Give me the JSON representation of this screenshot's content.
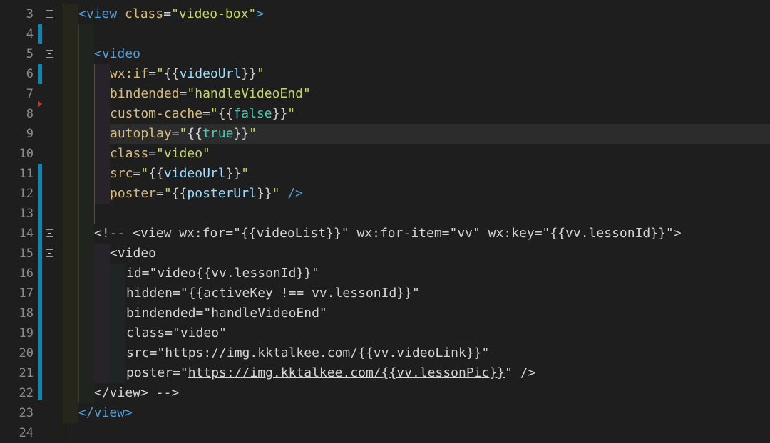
{
  "editor": {
    "line_numbers": [
      "3",
      "4",
      "5",
      "6",
      "7",
      "8",
      "9",
      "10",
      "11",
      "12",
      "13",
      "14",
      "15",
      "16",
      "17",
      "18",
      "19",
      "20",
      "21",
      "22",
      "23",
      "24"
    ],
    "lines": [
      {
        "t": "<view class=\"video-box\">"
      },
      {
        "t": ""
      },
      {
        "t": "<video"
      },
      {
        "t": "wx:if=\"{{videoUrl}}\""
      },
      {
        "t": "bindended=\"handleVideoEnd\""
      },
      {
        "t": "custom-cache=\"{{false}}\""
      },
      {
        "t": "autoplay=\"{{true}}\""
      },
      {
        "t": "class=\"video\""
      },
      {
        "t": "src=\"{{videoUrl}}\""
      },
      {
        "t": "poster=\"{{posterUrl}}\" />"
      },
      {
        "t": ""
      },
      {
        "t": "<!-- <view wx:for=\"{{videoList}}\" wx:for-item=\"vv\" wx:key=\"{{vv.lessonId}}\">"
      },
      {
        "t": "<video"
      },
      {
        "t": "id=\"video{{vv.lessonId}}\""
      },
      {
        "t": "hidden=\"{{activeKey !== vv.lessonId}}\""
      },
      {
        "t": "bindended=\"handleVideoEnd\""
      },
      {
        "t": "class=\"video\""
      },
      {
        "t": "src=\"https://img.kktalkee.com/{{vv.videoLink}}\""
      },
      {
        "t": "poster=\"https://img.kktalkee.com/{{vv.lessonPic}}\" />"
      },
      {
        "t": "</view> -->"
      },
      {
        "t": "</view>"
      },
      {
        "t": ""
      }
    ],
    "tokens": {
      "l3_tag": "<view",
      "l3_attr": " class",
      "l3_eq": "=",
      "l3_str": "\"video-box\"",
      "l3_close": ">",
      "l5_tag": "<video",
      "l6_attr": "wx:if",
      "l6_eq": "=",
      "l6_q1": "\"",
      "l6_m1": "{{",
      "l6_var": "videoUrl",
      "l6_m2": "}}",
      "l6_q2": "\"",
      "l7_attr": "bindended",
      "l7_eq": "=",
      "l7_str": "\"handleVideoEnd\"",
      "l8_attr": "custom-cache",
      "l8_eq": "=",
      "l8_q1": "\"",
      "l8_m1": "{{",
      "l8_bool": "false",
      "l8_m2": "}}",
      "l8_q2": "\"",
      "l9_attr": "autoplay",
      "l9_eq": "=",
      "l9_q1": "\"",
      "l9_m1": "{{",
      "l9_bool": "true",
      "l9_m2": "}}",
      "l9_q2": "\"",
      "l10_attr": "class",
      "l10_eq": "=",
      "l10_str": "\"video\"",
      "l11_attr": "src",
      "l11_eq": "=",
      "l11_q1": "\"",
      "l11_m1": "{{",
      "l11_var": "videoUrl",
      "l11_m2": "}}",
      "l11_q2": "\"",
      "l12_attr": "poster",
      "l12_eq": "=",
      "l12_q1": "\"",
      "l12_m1": "{{",
      "l12_var": "posterUrl",
      "l12_m2": "}}",
      "l12_q2": "\"",
      "l12_close": " />",
      "l14_text": "<!-- <view wx:for=\"{{videoList}}\" wx:for-item=\"vv\" wx:key=\"{{vv.lessonId}}\">",
      "l15_text": "<video",
      "l16_text": "id=\"video{{vv.lessonId}}\"",
      "l17_text": "hidden=\"{{activeKey !== vv.lessonId}}\"",
      "l18_text": "bindended=\"handleVideoEnd\"",
      "l19_text": "class=\"video\"",
      "l20_pre": "src=\"",
      "l20_link": "https://img.kktalkee.com/{{vv.videoLink}}",
      "l20_post": "\"",
      "l21_pre": "poster=\"",
      "l21_link": "https://img.kktalkee.com/{{vv.lessonPic}}",
      "l21_post": "\" />",
      "l22_text": "</view> -->",
      "l23_text": "</view>"
    }
  },
  "colors": {
    "background": "#1e1e1e",
    "tag": "#569cd6",
    "attribute": "#d7ba7d",
    "string": "#c5d76a",
    "variable": "#9cdcfe",
    "boolean": "#4ec9b0",
    "line_number": "#8a8a8a",
    "modified_bar": "#1b81a8"
  }
}
